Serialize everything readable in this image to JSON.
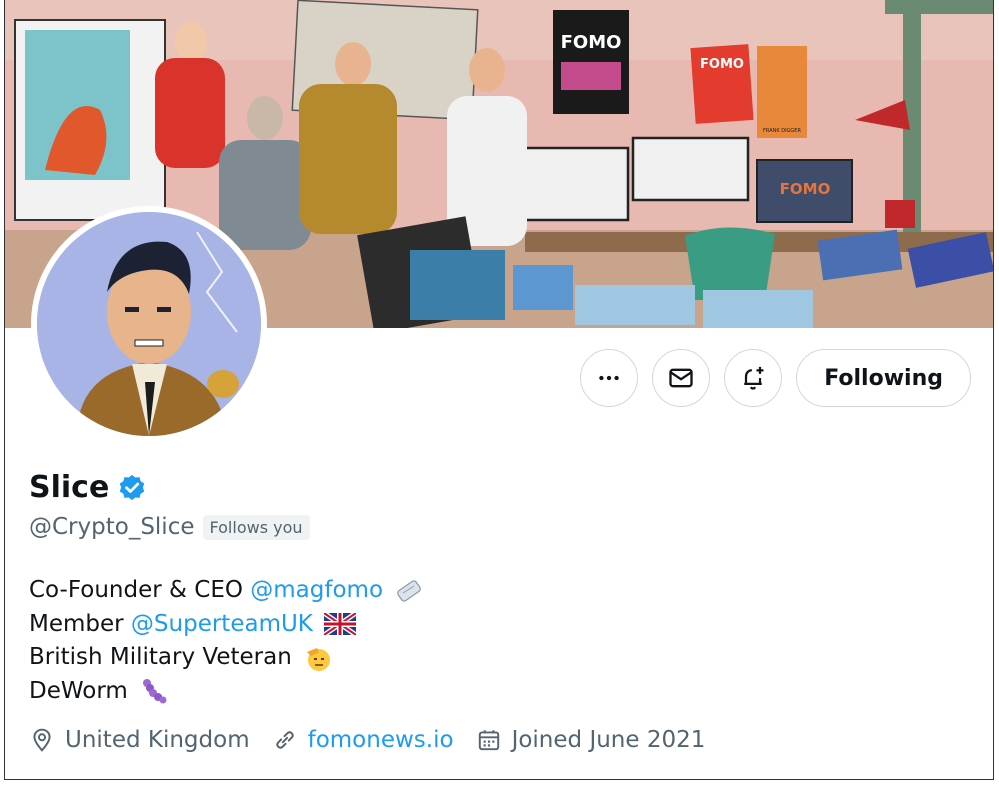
{
  "profile": {
    "name": "Slice",
    "handle": "@Crypto_Slice",
    "follows_you": "Follows you",
    "verified": true,
    "accent_color": "#1d9bf0"
  },
  "banner": {
    "poster_fomo": "FOMO",
    "poster_fomo_small": "FOMO",
    "screen_fomo": "FOMO",
    "laptop_brand": "FOMO",
    "poster_caption": "FRANK DIGGER"
  },
  "actions": {
    "more_icon": "more-icon",
    "message_icon": "mail-icon",
    "notify_icon": "bell-plus-icon",
    "following_label": "Following"
  },
  "bio": {
    "line1_text": "Co-Founder & CEO ",
    "line1_link": "@magfomo",
    "line2_text": "Member ",
    "line2_link": "@SuperteamUK",
    "line3_text": "British Military Veteran",
    "line4_text": "DeWorm"
  },
  "meta": {
    "location": "United Kingdom",
    "website": "fomonews.io",
    "joined": "Joined June 2021"
  }
}
